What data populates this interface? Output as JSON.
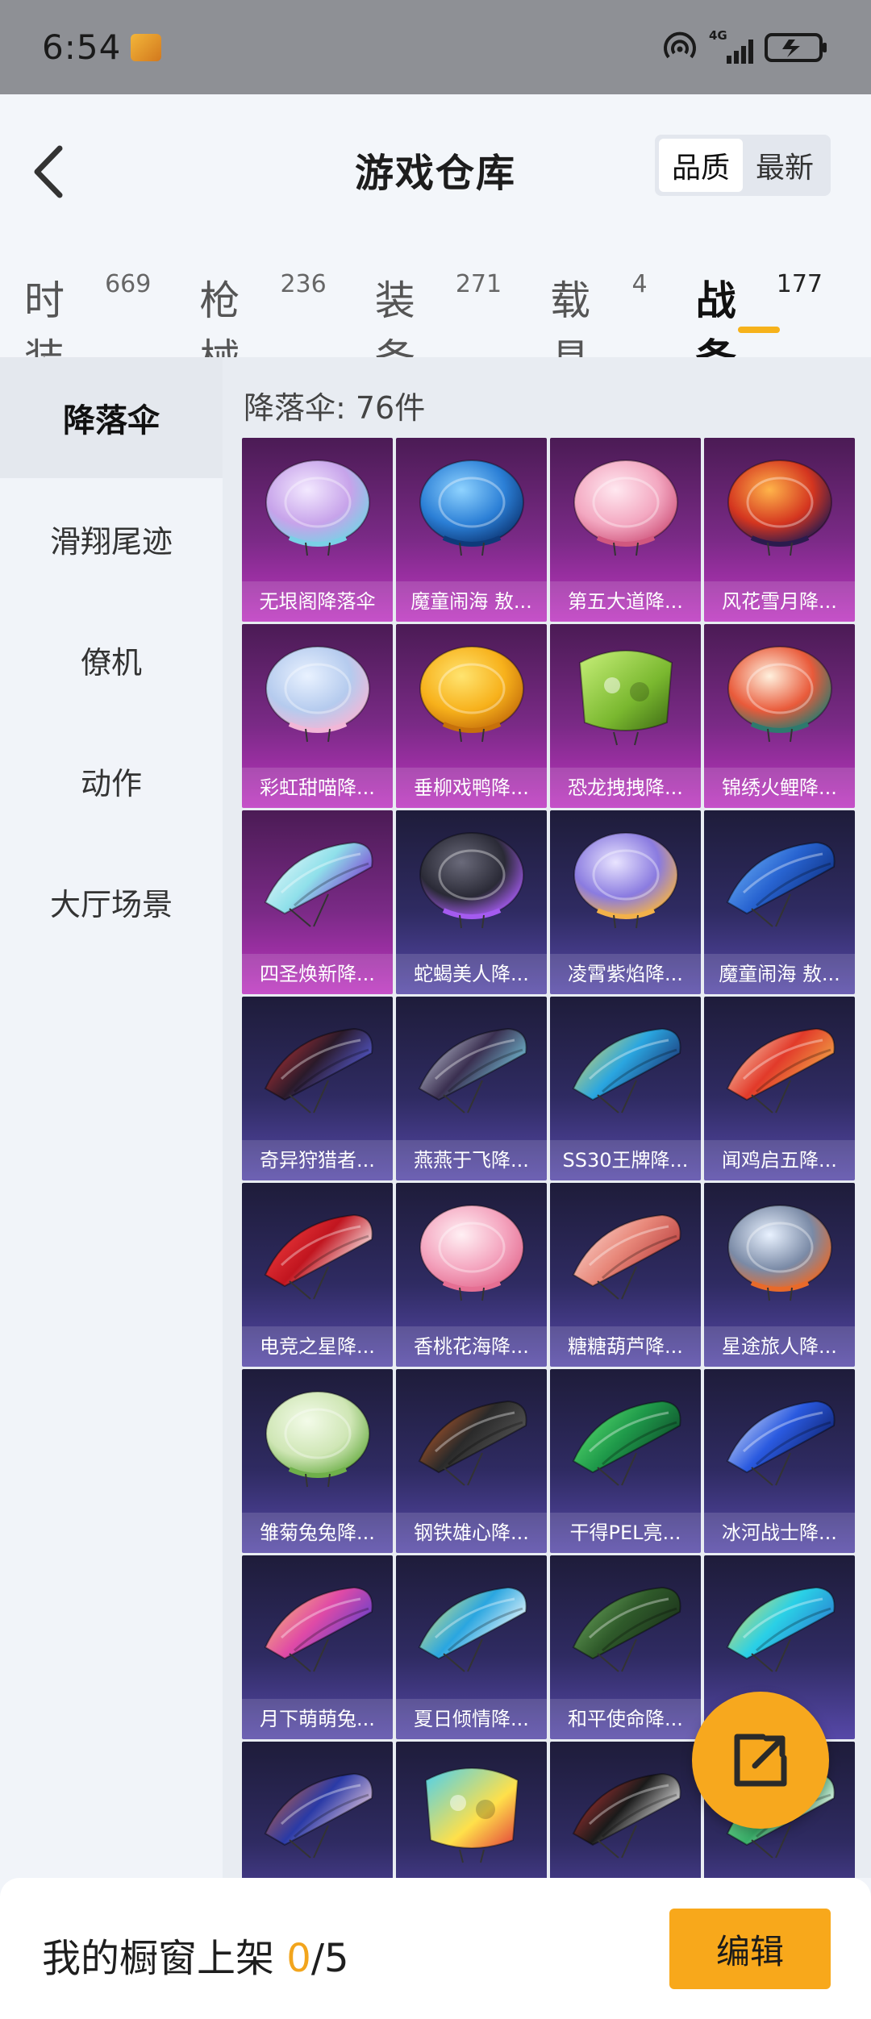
{
  "status_bar": {
    "time": "6:54",
    "app_icon_text": "和平精英",
    "network": "4G",
    "sim_index": "1"
  },
  "header": {
    "title": "游戏仓库",
    "back_icon": "chevron-left-icon",
    "sort_options": [
      {
        "label": "品质",
        "active": true
      },
      {
        "label": "最新",
        "active": false
      }
    ]
  },
  "tabs": [
    {
      "label": "时装",
      "count": "669",
      "active": false
    },
    {
      "label": "枪械",
      "count": "236",
      "active": false
    },
    {
      "label": "装备",
      "count": "271",
      "active": false
    },
    {
      "label": "载具",
      "count": "4",
      "active": false
    },
    {
      "label": "战备",
      "count": "177",
      "active": true
    }
  ],
  "sidebar": {
    "items": [
      {
        "label": "降落伞",
        "active": true
      },
      {
        "label": "滑翔尾迹",
        "active": false
      },
      {
        "label": "僚机",
        "active": false
      },
      {
        "label": "动作",
        "active": false
      },
      {
        "label": "大厅场景",
        "active": false
      }
    ]
  },
  "content": {
    "count_label": "降落伞: 76件",
    "items": [
      {
        "name": "无垠阁降落伞",
        "tier": "purple",
        "art": "round",
        "colors": [
          "#f3e9ff",
          "#c7a3ea",
          "#7ad0e6"
        ]
      },
      {
        "name": "魔童闹海 敖...",
        "tier": "purple",
        "art": "round",
        "colors": [
          "#8fd3ff",
          "#2b7fd6",
          "#0e3a7a"
        ]
      },
      {
        "name": "第五大道降...",
        "tier": "purple",
        "art": "round",
        "colors": [
          "#ffe8f0",
          "#f3a8c1",
          "#d1587f"
        ]
      },
      {
        "name": "风花雪月降...",
        "tier": "purple",
        "art": "round",
        "colors": [
          "#ffb44a",
          "#d4351f",
          "#2b1b4e"
        ]
      },
      {
        "name": "彩虹甜喵降...",
        "tier": "purple",
        "art": "round",
        "colors": [
          "#e9f2ff",
          "#b5cbee",
          "#f2b7d7"
        ]
      },
      {
        "name": "垂柳戏鸭降...",
        "tier": "purple",
        "art": "round",
        "colors": [
          "#ffe470",
          "#f7b11b",
          "#c6700b"
        ]
      },
      {
        "name": "恐龙拽拽降...",
        "tier": "purple",
        "art": "square",
        "colors": [
          "#c8f07a",
          "#7ab82f",
          "#3d6a14"
        ]
      },
      {
        "name": "锦绣火鲤降...",
        "tier": "purple",
        "art": "round",
        "colors": [
          "#fff1de",
          "#e95a3a",
          "#2d7a6e"
        ]
      },
      {
        "name": "四圣焕新降...",
        "tier": "purple",
        "art": "wing",
        "colors": [
          "#ffffff",
          "#8fe0ea",
          "#7a2fd0"
        ]
      },
      {
        "name": "蛇蝎美人降...",
        "tier": "blue",
        "art": "round",
        "colors": [
          "#6a6a7a",
          "#2a2a36",
          "#a45bf0"
        ]
      },
      {
        "name": "凌霄紫焰降...",
        "tier": "blue",
        "art": "round",
        "colors": [
          "#e9e4ff",
          "#8a7be0",
          "#f2b14a"
        ]
      },
      {
        "name": "魔童闹海 敖...",
        "tier": "blue",
        "art": "wing",
        "colors": [
          "#7ec3ff",
          "#2864d1",
          "#0e2f80"
        ]
      },
      {
        "name": "奇异狩猎者...",
        "tier": "blue",
        "art": "wing",
        "colors": [
          "#e23a3a",
          "#2a1a2a",
          "#5a62e6"
        ]
      },
      {
        "name": "燕燕于飞降...",
        "tier": "blue",
        "art": "wing",
        "colors": [
          "#e9f3ff",
          "#3a2f50",
          "#7ad0e6"
        ]
      },
      {
        "name": "SS30王牌降...",
        "tier": "blue",
        "art": "wing",
        "colors": [
          "#ffe04a",
          "#2aa6e0",
          "#1b2f70"
        ]
      },
      {
        "name": "闻鸡启五降...",
        "tier": "blue",
        "art": "wing",
        "colors": [
          "#fff4d6",
          "#e23a2a",
          "#f2b14a"
        ]
      },
      {
        "name": "电竞之星降...",
        "tier": "blue",
        "art": "wing",
        "colors": [
          "#ff4a4a",
          "#c1151f",
          "#ffffff"
        ]
      },
      {
        "name": "香桃花海降...",
        "tier": "blue",
        "art": "round",
        "colors": [
          "#fff0f4",
          "#f4a5bf",
          "#e56f93"
        ]
      },
      {
        "name": "糖糖葫芦降...",
        "tier": "blue",
        "art": "wing",
        "colors": [
          "#ffe6e0",
          "#e8887a",
          "#b83b3b"
        ]
      },
      {
        "name": "星途旅人降...",
        "tier": "blue",
        "art": "round",
        "colors": [
          "#e9f2ff",
          "#7a8aa6",
          "#e86a2a"
        ]
      },
      {
        "name": "雏菊兔兔降...",
        "tier": "blue",
        "art": "round",
        "colors": [
          "#f3fbe9",
          "#cfe6b5",
          "#6fb04a"
        ]
      },
      {
        "name": "钢铁雄心降...",
        "tier": "blue",
        "art": "wing",
        "colors": [
          "#e9692a",
          "#2a2a2a",
          "#5a5a5a"
        ]
      },
      {
        "name": "干得PEL亮...",
        "tier": "blue",
        "art": "wing",
        "colors": [
          "#6af07a",
          "#1f9a4a",
          "#0e4a2a"
        ]
      },
      {
        "name": "冰河战士降...",
        "tier": "blue",
        "art": "wing",
        "colors": [
          "#ffffff",
          "#2a5ae0",
          "#0e1f6a"
        ]
      },
      {
        "name": "月下萌萌兔...",
        "tier": "blue",
        "art": "wing",
        "colors": [
          "#ffd06a",
          "#e04aa6",
          "#5a3fd0"
        ]
      },
      {
        "name": "夏日倾情降...",
        "tier": "blue",
        "art": "wing",
        "colors": [
          "#fff06a",
          "#2aa6e0",
          "#ffffff"
        ]
      },
      {
        "name": "和平使命降...",
        "tier": "blue",
        "art": "wing",
        "colors": [
          "#7ab86a",
          "#2f5a2a",
          "#1a2f1a"
        ]
      },
      {
        "name": "",
        "tier": "blue",
        "art": "wing",
        "colors": [
          "#ffe04a",
          "#2ad0e6",
          "#2a7ad0"
        ]
      },
      {
        "name": "",
        "tier": "blue",
        "art": "wing",
        "colors": [
          "#e86a2a",
          "#2a3aa6",
          "#f2d0e0"
        ]
      },
      {
        "name": "",
        "tier": "blue",
        "art": "square",
        "colors": [
          "#4ad0f0",
          "#ffe04a",
          "#e23a3a"
        ]
      },
      {
        "name": "",
        "tier": "blue",
        "art": "wing",
        "colors": [
          "#e23a3a",
          "#1a1a1a",
          "#ffffff"
        ]
      },
      {
        "name": "",
        "tier": "blue",
        "art": "wing",
        "colors": [
          "#8ae6a0",
          "#3ab06a",
          "#ffffff"
        ]
      }
    ]
  },
  "fab": {
    "icon": "share-external-icon"
  },
  "bottom_bar": {
    "label": "我的橱窗上架 ",
    "current": "0",
    "total": "/5",
    "edit_label": "编辑"
  },
  "colors": {
    "accent": "#f7a81e",
    "purple_tier": "#bd35c0",
    "blue_tier": "#5648a8"
  }
}
